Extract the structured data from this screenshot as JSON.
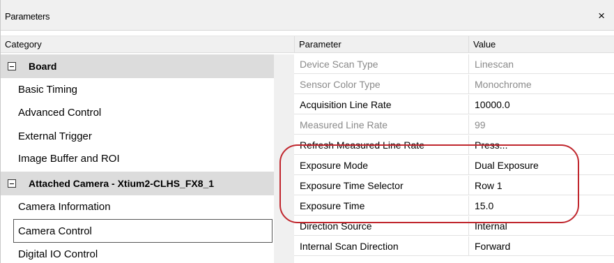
{
  "window": {
    "title": "Parameters",
    "close_label": "×"
  },
  "headers": {
    "category": "Category",
    "parameter": "Parameter",
    "value": "Value"
  },
  "categories": [
    {
      "label": "Board"
    },
    {
      "label": "Basic Timing"
    },
    {
      "label": "Advanced Control"
    },
    {
      "label": "External Trigger"
    },
    {
      "label": "Image Buffer and ROI"
    },
    {
      "label": "Attached Camera - Xtium2-CLHS_FX8_1"
    },
    {
      "label": "Camera Information"
    },
    {
      "label": "Camera Control"
    },
    {
      "label": "Digital IO Control"
    }
  ],
  "parameters": [
    {
      "name": "Device Scan Type",
      "value": "Linescan"
    },
    {
      "name": "Sensor Color Type",
      "value": "Monochrome"
    },
    {
      "name": "Acquisition Line Rate",
      "value": "10000.0"
    },
    {
      "name": "Measured Line Rate",
      "value": "99"
    },
    {
      "name": "Refresh Measured Line Rate",
      "value": "Press..."
    },
    {
      "name": "Exposure Mode",
      "value": "Dual Exposure"
    },
    {
      "name": "Exposure Time Selector",
      "value": "Row 1"
    },
    {
      "name": "Exposure Time",
      "value": "15.0"
    },
    {
      "name": "Direction Source",
      "value": "Internal"
    },
    {
      "name": "Internal Scan Direction",
      "value": "Forward"
    }
  ],
  "colors": {
    "annotation": "#c0262d",
    "group_bg": "#dcdcdc",
    "dim_text": "#8a8a8a"
  },
  "icons": {
    "collapse": "box-minus-icon"
  }
}
